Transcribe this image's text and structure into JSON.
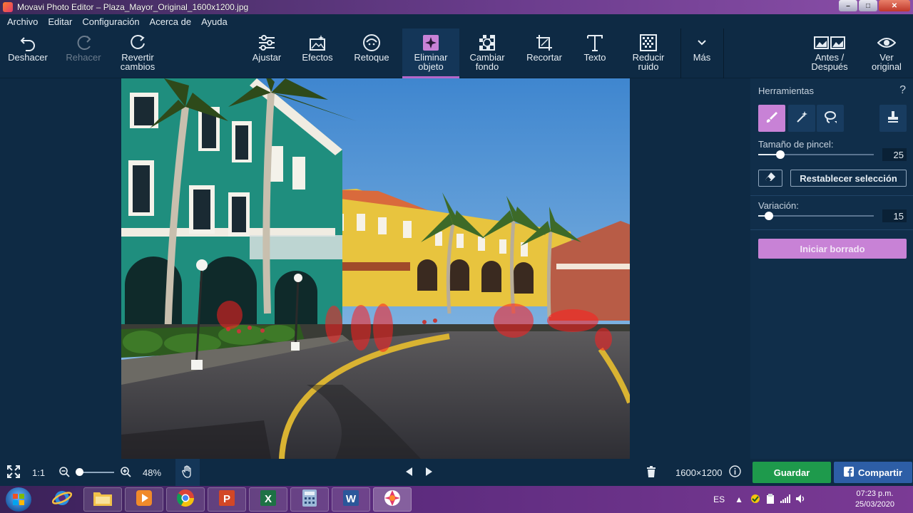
{
  "window": {
    "title": "Movavi Photo Editor – Plaza_Mayor_Original_1600x1200.jpg"
  },
  "menu": [
    "Archivo",
    "Editar",
    "Configuración",
    "Acerca de",
    "Ayuda"
  ],
  "toolbar": {
    "undo": "Deshacer",
    "redo": "Rehacer",
    "revert": "Revertir\ncambios",
    "adjust": "Ajustar",
    "effects": "Efectos",
    "retouch": "Retoque",
    "remove_object": "Eliminar\nobjeto",
    "change_bg": "Cambiar\nfondo",
    "crop": "Recortar",
    "text": "Texto",
    "denoise": "Reducir\nruido",
    "more": "Más",
    "before_after": "Antes /\nDespués",
    "view_original": "Ver\noriginal",
    "active_tool": "remove_object"
  },
  "panel": {
    "title": "Herramientas",
    "help": "?",
    "tools": [
      "brush-icon",
      "magic-wand-icon",
      "lasso-icon",
      "stamp-icon"
    ],
    "brush_size_label": "Tamaño de pincel:",
    "brush_size": "25",
    "brush_size_fraction": 0.19,
    "reset_selection": "Restablecer selección",
    "variation_label": "Variación:",
    "variation": "15",
    "variation_fraction": 0.09,
    "start_erase": "Iniciar borrado"
  },
  "bottombar": {
    "fit": "fit-screen-icon",
    "one_to_one": "1:1",
    "zoom": "48%",
    "zoom_fraction": 0.0,
    "dimensions": "1600×1200",
    "save": "Guardar",
    "share": "Compartir"
  },
  "taskbar": {
    "language": "ES",
    "time": "07:23 p.m.",
    "date": "25/03/2020"
  },
  "colors": {
    "accent": "#c882d6",
    "save": "#1e9a4c",
    "share": "#2d5ea6",
    "selection_mask": "#ff1e1e"
  }
}
